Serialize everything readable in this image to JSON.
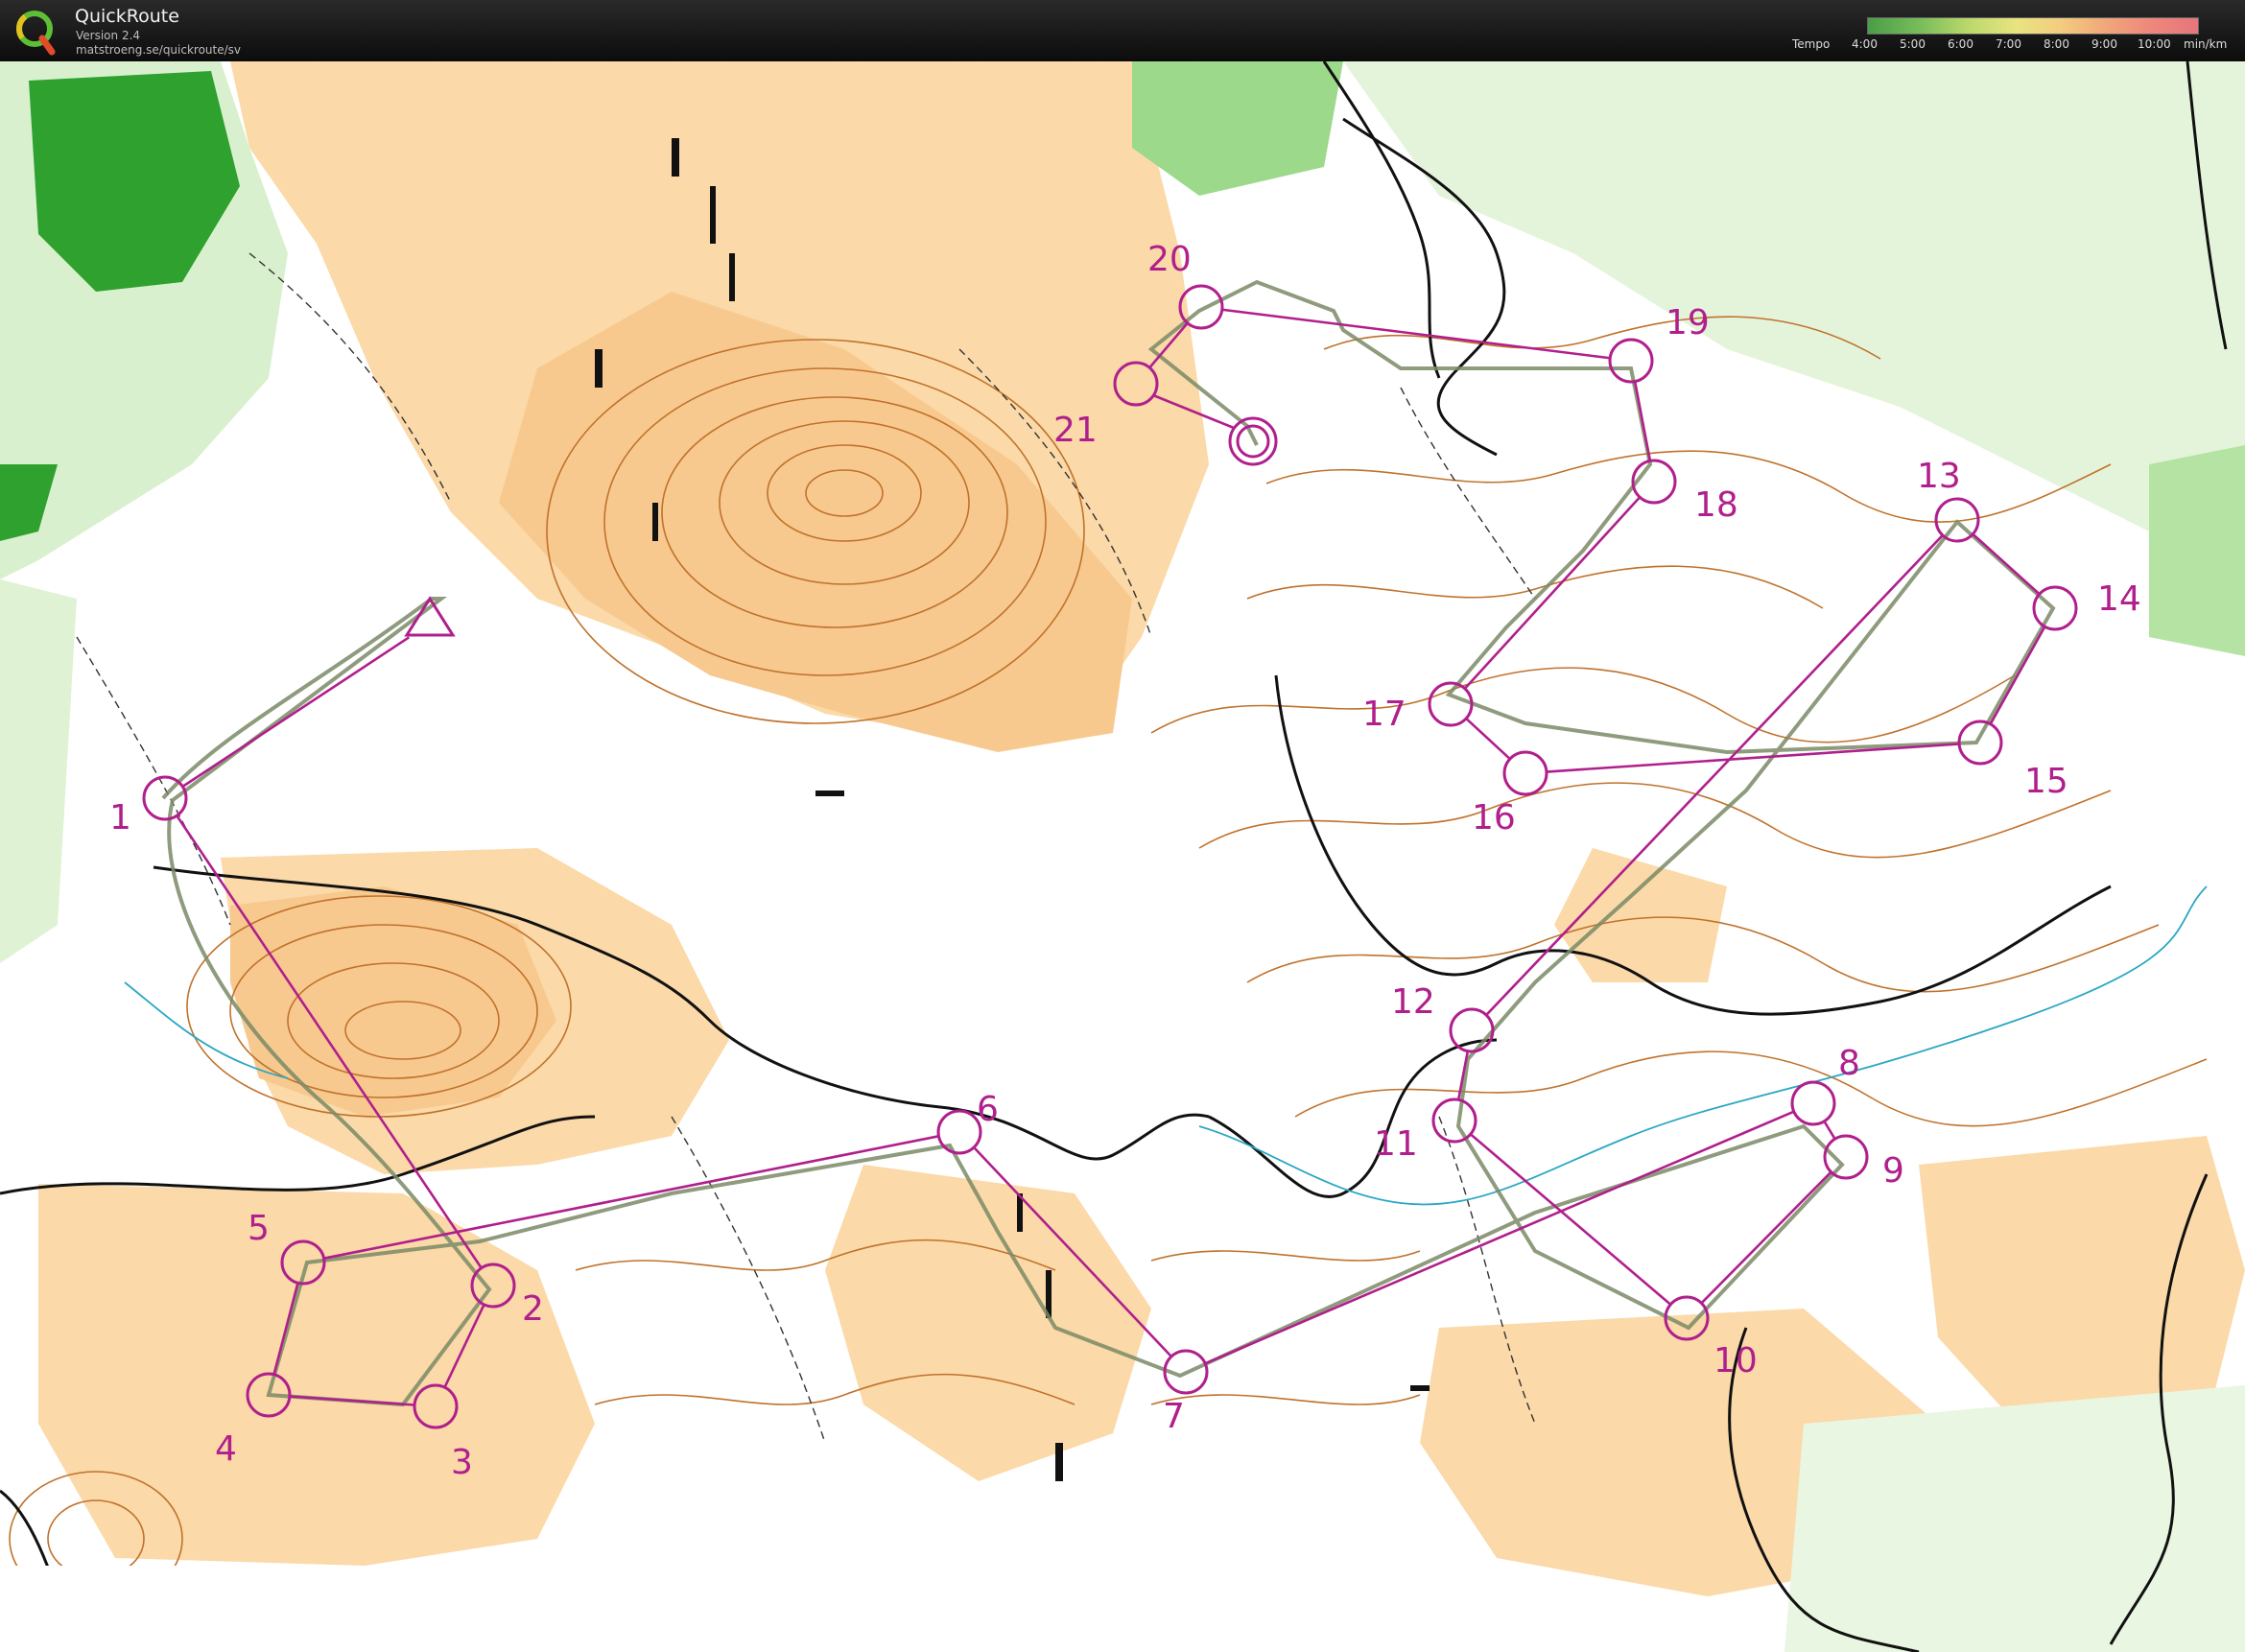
{
  "app": {
    "title": "QuickRoute",
    "version": "Version 2.4",
    "url": "matstroeng.se/quickroute/sv"
  },
  "legend": {
    "label": "Tempo",
    "ticks": [
      "4:00",
      "5:00",
      "6:00",
      "7:00",
      "8:00",
      "9:00",
      "10:00"
    ],
    "unit": "min/km"
  },
  "course": {
    "color": "#b01f8c",
    "controls": [
      "1",
      "2",
      "3",
      "4",
      "5",
      "6",
      "7",
      "8",
      "9",
      "10",
      "11",
      "12",
      "13",
      "14",
      "15",
      "16",
      "17",
      "18",
      "19",
      "20",
      "21"
    ]
  }
}
